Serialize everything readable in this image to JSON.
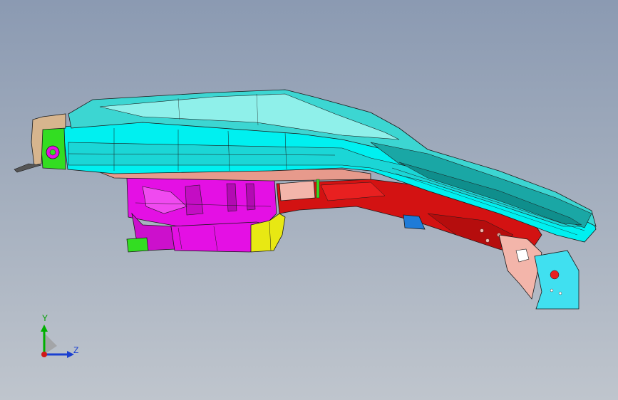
{
  "viewport": {
    "background_top": "#8b9ab2",
    "background_bottom": "#bfc5cd"
  },
  "model": {
    "part_colors": {
      "top_panel": "#3cd6d2",
      "top_panel_dark": "#1aa7a5",
      "top_panel_light": "#8ff0ea",
      "side_rail": "#00f0f0",
      "salmon_flange": "#e79a8c",
      "magenta_bracket": "#e410e4",
      "yellow_block": "#e8e813",
      "red_member": "#d31212",
      "green_part": "#33dd22",
      "blue_part": "#1e7bd8",
      "tan_part": "#d7b58e",
      "pink_part": "#f3b5aa",
      "edge_color": "#1a1a1a"
    }
  },
  "triad": {
    "y_label": "Y",
    "z_label": "Z",
    "y_color": "#00b000",
    "z_color": "#1a3fd0",
    "x_color": "#d01818",
    "label_y_color": "#00a000",
    "label_z_color": "#1a3fd0"
  }
}
